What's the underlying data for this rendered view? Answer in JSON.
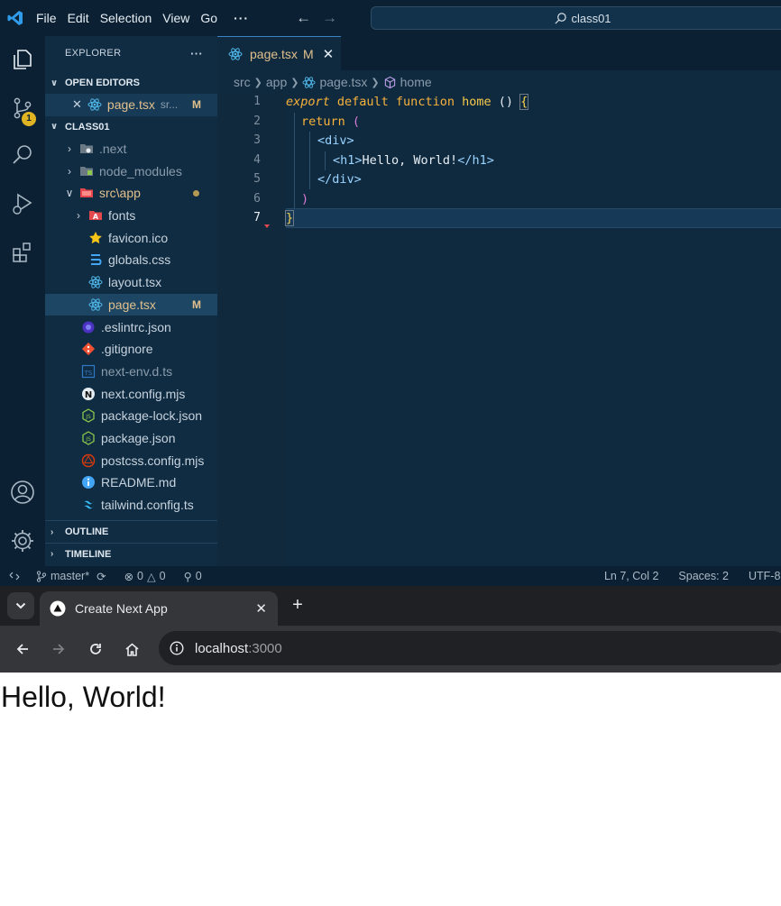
{
  "vscode": {
    "menu": [
      "File",
      "Edit",
      "Selection",
      "View",
      "Go"
    ],
    "menu_more": "···",
    "search_text": "class01",
    "scm_badge": "1",
    "explorer": {
      "title": "EXPLORER",
      "more": "···",
      "open_editors": {
        "title": "OPEN EDITORS",
        "item_name": "page.tsx",
        "item_path": "sr...",
        "item_status": "M"
      },
      "folder": {
        "title": "CLASS01",
        "tree": [
          {
            "label": ".next"
          },
          {
            "label": "node_modules"
          },
          {
            "label": "src\\app"
          },
          {
            "label": "fonts"
          },
          {
            "label": "favicon.ico"
          },
          {
            "label": "globals.css"
          },
          {
            "label": "layout.tsx"
          },
          {
            "label": "page.tsx",
            "status": "M"
          },
          {
            "label": ".eslintrc.json"
          },
          {
            "label": ".gitignore"
          },
          {
            "label": "next-env.d.ts"
          },
          {
            "label": "next.config.mjs"
          },
          {
            "label": "package-lock.json"
          },
          {
            "label": "package.json"
          },
          {
            "label": "postcss.config.mjs"
          },
          {
            "label": "README.md"
          },
          {
            "label": "tailwind.config.ts"
          }
        ]
      },
      "outline": "OUTLINE",
      "timeline": "TIMELINE"
    },
    "tab": {
      "label": "page.tsx",
      "status": "M",
      "close": "✕"
    },
    "breadcrumb": [
      "src",
      "app",
      "page.tsx",
      "home"
    ],
    "line_numbers": [
      "1",
      "2",
      "3",
      "4",
      "5",
      "6",
      "7"
    ],
    "code": {
      "l1_a": "export",
      "l1_b": " default function ",
      "l1_c": "home",
      "l1_d": " () ",
      "l1_e": "{",
      "l2_a": "return",
      "l2_b": " (",
      "l3": "<div>",
      "l4_a": "<h1>",
      "l4_b": "Hello, World!",
      "l4_c": "</h1>",
      "l5": "</div>",
      "l6": ")",
      "l7": "}"
    },
    "status": {
      "branch": "master*",
      "errors": "0",
      "warnings": "0",
      "ports": "0",
      "position": "Ln 7, Col 2",
      "spaces": "Spaces: 2",
      "encoding": "UTF-8"
    }
  },
  "browser": {
    "tab_title": "Create Next App",
    "tab_close": "✕",
    "new_tab": "+",
    "url_host": "localhost",
    "url_port": ":3000"
  },
  "page": {
    "heading": "Hello, World!"
  },
  "colors": {
    "editor_bg": "#0f2a3f",
    "modified": "#e2c08d",
    "keyword": "#f7b23b",
    "tag": "#9ad3ff"
  }
}
